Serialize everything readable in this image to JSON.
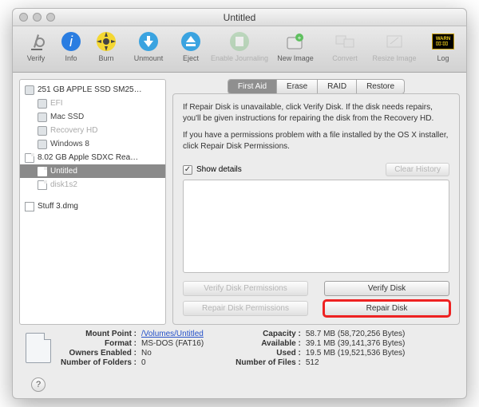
{
  "window": {
    "title": "Untitled"
  },
  "toolbar": {
    "verify": "Verify",
    "info": "Info",
    "burn": "Burn",
    "unmount": "Unmount",
    "eject": "Eject",
    "enable_journaling": "Enable Journaling",
    "new_image": "New Image",
    "convert": "Convert",
    "resize_image": "Resize Image",
    "log": "Log"
  },
  "sidebar": {
    "items": [
      {
        "label": "251 GB APPLE SSD SM25…",
        "type": "disk"
      },
      {
        "label": "EFI",
        "type": "vol",
        "dim": true
      },
      {
        "label": "Mac SSD",
        "type": "vol"
      },
      {
        "label": "Recovery HD",
        "type": "vol",
        "dim": true
      },
      {
        "label": "Windows 8",
        "type": "vol"
      },
      {
        "label": "8.02 GB Apple SDXC Rea…",
        "type": "disk"
      },
      {
        "label": "Untitled",
        "type": "vol",
        "selected": true
      },
      {
        "label": "disk1s2",
        "type": "vol",
        "dim": true
      },
      {
        "label": "Stuff 3.dmg",
        "type": "dmg"
      }
    ]
  },
  "tabs": {
    "first_aid": "First Aid",
    "erase": "Erase",
    "raid": "RAID",
    "restore": "Restore"
  },
  "panel": {
    "instr1": "If Repair Disk is unavailable, click Verify Disk. If the disk needs repairs, you'll be given instructions for repairing the disk from the Recovery HD.",
    "instr2": "If you have a permissions problem with a file installed by the OS X installer, click Repair Disk Permissions.",
    "show_details": "Show details",
    "clear_history": "Clear History",
    "verify_perm": "Verify Disk Permissions",
    "verify_disk": "Verify Disk",
    "repair_perm": "Repair Disk Permissions",
    "repair_disk": "Repair Disk"
  },
  "footer": {
    "left": {
      "mount_point_k": "Mount Point :",
      "mount_point_v": "/Volumes/Untitled",
      "format_k": "Format :",
      "format_v": "MS-DOS (FAT16)",
      "owners_k": "Owners Enabled :",
      "owners_v": "No",
      "folders_k": "Number of Folders :",
      "folders_v": "0"
    },
    "right": {
      "capacity_k": "Capacity :",
      "capacity_v": "58.7 MB (58,720,256 Bytes)",
      "available_k": "Available :",
      "available_v": "39.1 MB (39,141,376 Bytes)",
      "used_k": "Used :",
      "used_v": "19.5 MB (19,521,536 Bytes)",
      "files_k": "Number of Files :",
      "files_v": "512"
    }
  }
}
